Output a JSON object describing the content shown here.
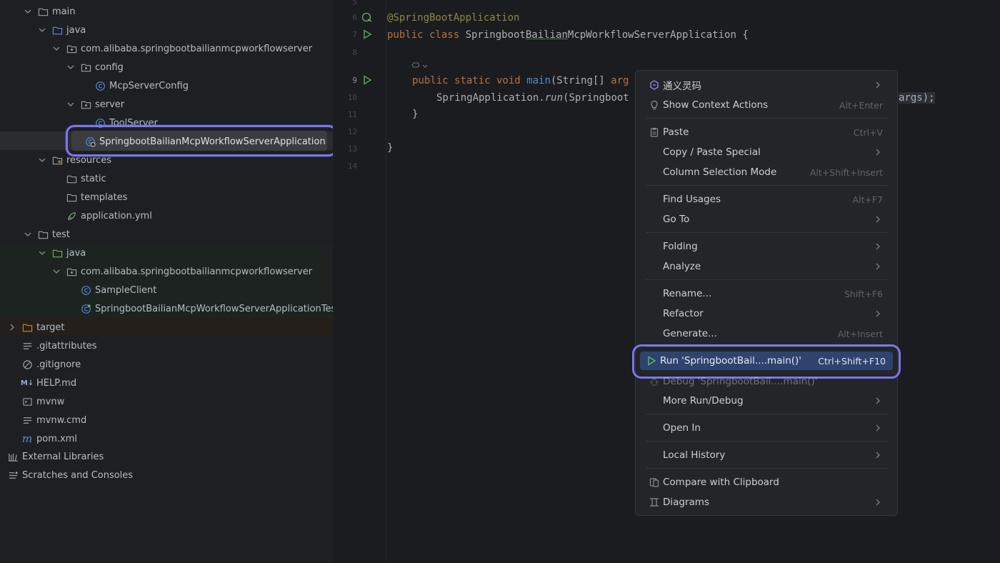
{
  "tree": {
    "rows": [
      {
        "label": "main",
        "icon": "folder-icon"
      },
      {
        "label": "java",
        "icon": "source-folder-icon"
      },
      {
        "label": "com.alibaba.springbootbailianmcpworkflowserver",
        "icon": "package-icon"
      },
      {
        "label": "config",
        "icon": "package-icon"
      },
      {
        "label": "McpServerConfig",
        "icon": "class-icon"
      },
      {
        "label": "server",
        "icon": "package-icon"
      },
      {
        "label": "ToolServer",
        "icon": "class-icon"
      },
      {
        "label": "SpringbootBailianMcpWorkflowServerApplication",
        "icon": "spring-class-icon"
      },
      {
        "label": "resources",
        "icon": "resources-folder-icon"
      },
      {
        "label": "static",
        "icon": "folder-icon"
      },
      {
        "label": "templates",
        "icon": "folder-icon"
      },
      {
        "label": "application.yml",
        "icon": "yaml-file-icon"
      },
      {
        "label": "test",
        "icon": "folder-icon"
      },
      {
        "label": "java",
        "icon": "test-folder-icon"
      },
      {
        "label": "com.alibaba.springbootbailianmcpworkflowserver",
        "icon": "package-icon"
      },
      {
        "label": "SampleClient",
        "icon": "class-icon"
      },
      {
        "label": "SpringbootBailianMcpWorkflowServerApplicationTes",
        "icon": "test-class-icon"
      },
      {
        "label": "target",
        "icon": "folder-icon"
      },
      {
        "label": ".gitattributes",
        "icon": "text-file-icon"
      },
      {
        "label": ".gitignore",
        "icon": "ignore-file-icon"
      },
      {
        "label": "HELP.md",
        "icon": "markdown-file-icon"
      },
      {
        "label": "mvnw",
        "icon": "script-file-icon"
      },
      {
        "label": "mvnw.cmd",
        "icon": "text-file-icon"
      },
      {
        "label": "pom.xml",
        "icon": "maven-icon"
      },
      {
        "label": "External Libraries",
        "icon": "libraries-icon"
      },
      {
        "label": "Scratches and Consoles",
        "icon": "scratches-icon"
      }
    ],
    "markdown_badge": "M↓",
    "maven_badge": "m"
  },
  "editor": {
    "line_numbers": [
      "5",
      "6",
      "7",
      "8",
      "9",
      "10",
      "11",
      "12",
      "13",
      "14"
    ],
    "lines": {
      "l6": "@SpringBootApplication",
      "l7_kw": "public class ",
      "l7_a": "Springboot",
      "l7_b": "Bailian",
      "l7_c": "McpWorkflowServerApplication {",
      "l9_kw": "public static void ",
      "l9_fn": "main",
      "l9_rest": "(String[] ",
      "l9_param": "arg",
      "l10_a": "SpringApplication.",
      "l10_fn": "run",
      "l10_b": "(Springboot",
      "l10_tail": "args);",
      "l11": "}",
      "l13": "}"
    }
  },
  "menu": {
    "items": [
      {
        "label": "通义灵码",
        "shortcut": "",
        "submenu": true,
        "icon": "tongyi-icon"
      },
      {
        "label": "Show Context Actions",
        "shortcut": "Alt+Enter",
        "submenu": false,
        "icon": "lightbulb-icon"
      },
      {
        "label": "Paste",
        "shortcut": "Ctrl+V",
        "submenu": false,
        "icon": "paste-icon"
      },
      {
        "label": "Copy / Paste Special",
        "shortcut": "",
        "submenu": true,
        "icon": ""
      },
      {
        "label": "Column Selection Mode",
        "shortcut": "Alt+Shift+Insert",
        "submenu": false,
        "icon": ""
      },
      {
        "label": "Find Usages",
        "shortcut": "Alt+F7",
        "submenu": false,
        "icon": ""
      },
      {
        "label": "Go To",
        "shortcut": "",
        "submenu": true,
        "icon": ""
      },
      {
        "label": "Folding",
        "shortcut": "",
        "submenu": true,
        "icon": ""
      },
      {
        "label": "Analyze",
        "shortcut": "",
        "submenu": true,
        "icon": ""
      },
      {
        "label": "Rename...",
        "shortcut": "Shift+F6",
        "submenu": false,
        "icon": ""
      },
      {
        "label": "Refactor",
        "shortcut": "",
        "submenu": true,
        "icon": ""
      },
      {
        "label": "Generate...",
        "shortcut": "Alt+Insert",
        "submenu": false,
        "icon": ""
      },
      {
        "label": "Run 'SpringbootBail....main()'",
        "shortcut": "Ctrl+Shift+F10",
        "submenu": false,
        "icon": "run-icon"
      },
      {
        "label": "Debug 'SpringbootBail....main()'",
        "shortcut": "",
        "submenu": false,
        "icon": "debug-icon"
      },
      {
        "label": "More Run/Debug",
        "shortcut": "",
        "submenu": true,
        "icon": ""
      },
      {
        "label": "Open In",
        "shortcut": "",
        "submenu": true,
        "icon": ""
      },
      {
        "label": "Local History",
        "shortcut": "",
        "submenu": true,
        "icon": ""
      },
      {
        "label": "Compare with Clipboard",
        "shortcut": "",
        "submenu": false,
        "icon": "compare-icon"
      },
      {
        "label": "Diagrams",
        "shortcut": "",
        "submenu": true,
        "icon": "diagram-icon"
      }
    ]
  },
  "colors": {
    "highlight_ring": "#7b76f0",
    "run_selected": "#2e436e",
    "run_green": "#5fb865"
  }
}
